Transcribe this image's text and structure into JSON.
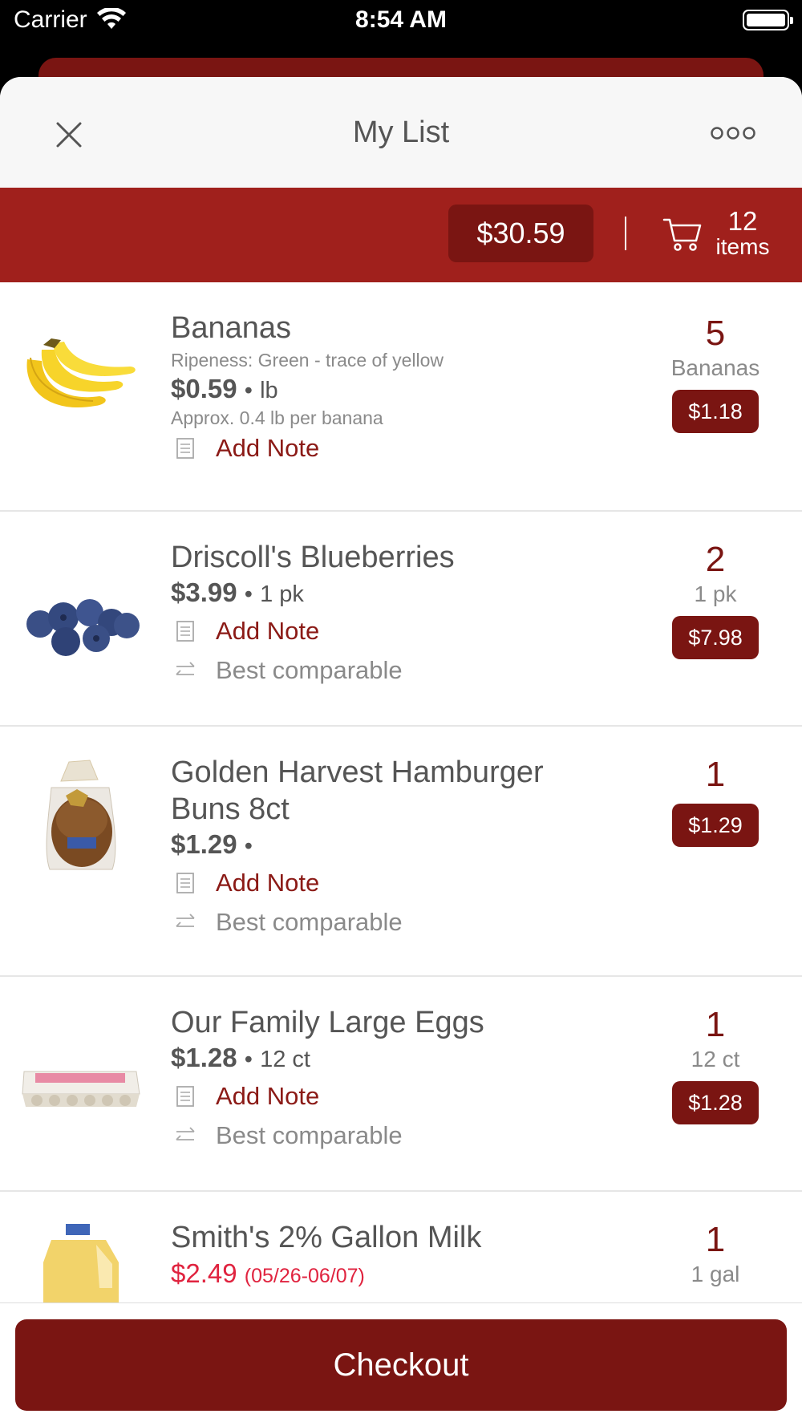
{
  "status_bar": {
    "carrier": "Carrier",
    "time": "8:54 AM"
  },
  "header": {
    "title": "My List",
    "close_icon": "close-icon",
    "more_icon": "more-icon"
  },
  "summary": {
    "total": "$30.59",
    "item_count": "12",
    "items_label": "items",
    "cart_icon": "cart-icon"
  },
  "colors": {
    "brand": "#a0201c",
    "brand_dark": "#7a1512",
    "sale": "#e0233f"
  },
  "items": [
    {
      "name": "Bananas",
      "ripeness": "Ripeness: Green - trace of yellow",
      "price": "$0.59",
      "sep": "•",
      "unit": "lb",
      "approx": "Approx. 0.4 lb per banana",
      "add_note": "Add Note",
      "qty": "5",
      "qty_unit": "Bananas",
      "line_total": "$1.18"
    },
    {
      "name": "Driscoll's Blueberries",
      "price": "$3.99",
      "sep": "•",
      "unit": "1 pk",
      "add_note": "Add Note",
      "best_comparable": "Best comparable",
      "qty": "2",
      "qty_unit": "1 pk",
      "line_total": "$7.98"
    },
    {
      "name": "Golden Harvest Hamburger Buns 8ct",
      "price": "$1.29",
      "sep": "•",
      "add_note": "Add Note",
      "best_comparable": "Best comparable",
      "qty": "1",
      "line_total": "$1.29"
    },
    {
      "name": "Our Family Large Eggs",
      "price": "$1.28",
      "sep": "•",
      "unit": "12 ct",
      "add_note": "Add Note",
      "best_comparable": "Best comparable",
      "qty": "1",
      "qty_unit": "12 ct",
      "line_total": "$1.28"
    },
    {
      "name": "Smith's 2% Gallon Milk",
      "sale_price": "$2.49",
      "sale_dates": "(05/26-06/07)",
      "qty": "1",
      "qty_unit": "1 gal"
    }
  ],
  "checkout": {
    "label": "Checkout"
  }
}
